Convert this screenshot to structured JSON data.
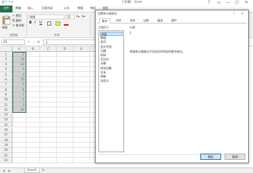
{
  "window": {
    "title": "工作簿1 - Excel",
    "qat": "⎙ ↶ ↷ ▾",
    "controls": [
      "?",
      "▭",
      "—",
      "▢",
      "✕"
    ]
  },
  "ribbon": {
    "tabs": [
      "文件",
      "开始",
      "插入",
      "页面布局",
      "公式",
      "数据",
      "审阅",
      "视图"
    ],
    "clipboard": {
      "paste_label": "粘贴",
      "cut": "✂ 剪切",
      "copy": "⎘ 复制",
      "format_painter": "✐ 格式刷",
      "group_label": "剪贴板"
    },
    "font": {
      "name": "宋体",
      "size": "11",
      "bold": "B",
      "italic": "I",
      "underline": "U",
      "group_label": "字体"
    }
  },
  "formula_bar": {
    "name_box": "A1",
    "fx": "fx",
    "value": "1"
  },
  "sheet": {
    "columns": [
      "A",
      "B",
      "C",
      "D",
      "E",
      "F",
      "G"
    ],
    "rows": [
      "1",
      "2",
      "3",
      "4",
      "5",
      "6",
      "7",
      "8",
      "9",
      "10",
      "11",
      "12",
      "13",
      "14",
      "15",
      "16",
      "17",
      "18",
      "19",
      "20",
      "21",
      "22"
    ],
    "col_a_values": [
      "1",
      "10",
      "22",
      "3",
      "4",
      "55",
      "5",
      "6",
      "7",
      "2",
      "3",
      "55"
    ],
    "tab_name": "Sheet1"
  },
  "dialog": {
    "title": "设置单元格格式",
    "tabs": [
      "数字",
      "对齐",
      "字体",
      "边框",
      "填充",
      "保护"
    ],
    "active_tab": "数字",
    "category_label": "分类(C):",
    "categories": [
      "常规",
      "数值",
      "货币",
      "会计专用",
      "日期",
      "时间",
      "百分比",
      "分数",
      "科学记数",
      "文本",
      "特殊",
      "自定义"
    ],
    "selected_category": "常规",
    "sample_label": "示例",
    "sample_value": "1",
    "description": "常规单元格格式不包含任何特定的数字格式。",
    "ok_label": "确定",
    "cancel_label": "取消"
  },
  "colors": {
    "excel_green": "#217346",
    "selection": "#cce4f7"
  }
}
